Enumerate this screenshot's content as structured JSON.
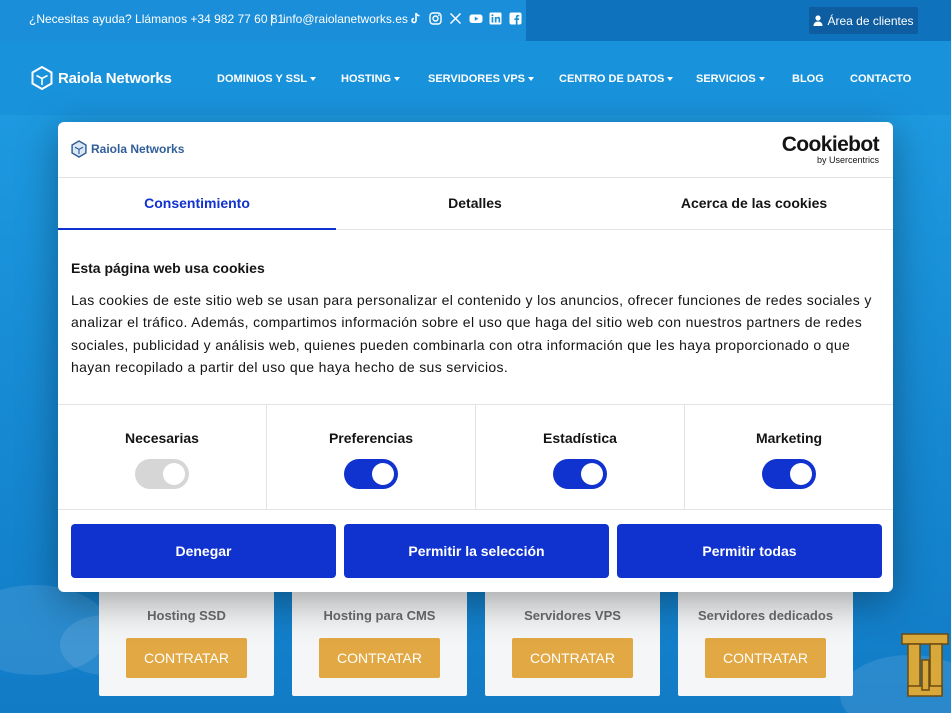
{
  "topbar": {
    "help_text": "¿Necesitas ayuda? Llámanos +34 982 77 60 81",
    "separator": "|",
    "email": "info@raiolanetworks.es",
    "socials": [
      "tiktok-icon",
      "instagram-icon",
      "x-icon",
      "youtube-icon",
      "linkedin-icon",
      "facebook-icon"
    ],
    "client_area": "Área de clientes"
  },
  "nav": {
    "logo": "Raiola Networks",
    "items": [
      {
        "label": "DOMINIOS Y SSL",
        "dropdown": true
      },
      {
        "label": "HOSTING",
        "dropdown": true
      },
      {
        "label": "SERVIDORES VPS",
        "dropdown": true
      },
      {
        "label": "CENTRO DE DATOS",
        "dropdown": true
      },
      {
        "label": "SERVICIOS",
        "dropdown": true
      },
      {
        "label": "BLOG",
        "dropdown": false
      },
      {
        "label": "CONTACTO",
        "dropdown": false
      }
    ]
  },
  "products": [
    {
      "title": "Hosting SSD",
      "button": "CONTRATAR"
    },
    {
      "title": "Hosting para CMS",
      "button": "CONTRATAR"
    },
    {
      "title": "Servidores VPS",
      "button": "CONTRATAR"
    },
    {
      "title": "Servidores dedicados",
      "button": "CONTRATAR"
    }
  ],
  "cookie_dialog": {
    "logo": "Raiola Networks",
    "provider": "Cookiebot",
    "provider_sub": "by Usercentrics",
    "tabs": [
      {
        "label": "Consentimiento",
        "active": true
      },
      {
        "label": "Detalles",
        "active": false
      },
      {
        "label": "Acerca de las cookies",
        "active": false
      }
    ],
    "heading": "Esta página web usa cookies",
    "body": "Las cookies de este sitio web se usan para personalizar el contenido y los anuncios, ofrecer funciones de redes sociales y analizar el tráfico. Además, compartimos información sobre el uso que haga del sitio web con nuestros partners de redes sociales, publicidad y análisis web, quienes pueden combinarla con otra información que les haya proporcionado o que hayan recopilado a partir del uso que haya hecho de sus servicios.",
    "categories": [
      {
        "label": "Necesarias",
        "checked": true,
        "disabled": true
      },
      {
        "label": "Preferencias",
        "checked": true,
        "disabled": false
      },
      {
        "label": "Estadística",
        "checked": true,
        "disabled": false
      },
      {
        "label": "Marketing",
        "checked": true,
        "disabled": false
      }
    ],
    "buttons": {
      "deny": "Denegar",
      "allow_selection": "Permitir la selección",
      "allow_all": "Permitir todas"
    }
  },
  "colors": {
    "brand_blue": "#1992dc",
    "cookiebot_blue": "#1032cf",
    "cta_orange": "#e2a843"
  }
}
